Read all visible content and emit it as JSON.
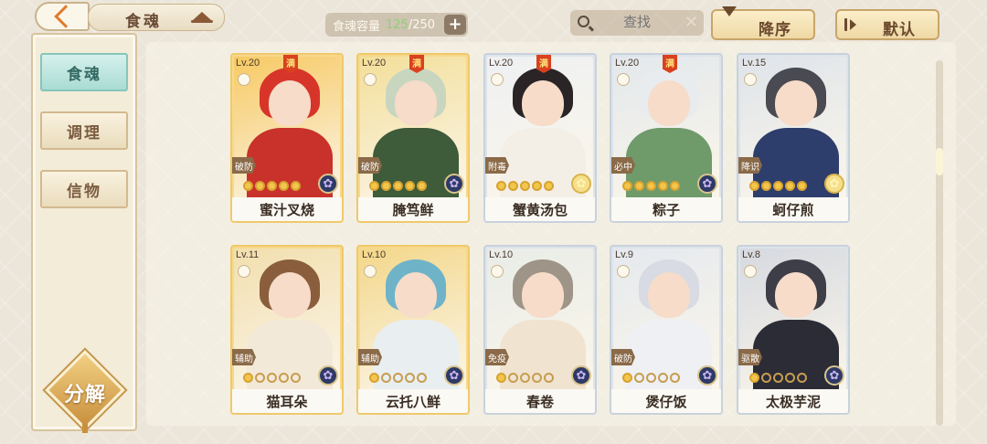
{
  "header": {
    "title": "食魂",
    "capacity_label": "食魂容量",
    "capacity_current": "125",
    "capacity_total": "/250",
    "add_label": "+",
    "search_placeholder": "查找",
    "clear_label": "✕",
    "sort_order_label": "降序",
    "sort_mode_label": "默认"
  },
  "sidebar": {
    "items": [
      {
        "label": "食魂",
        "active": true
      },
      {
        "label": "调理",
        "active": false
      },
      {
        "label": "信物",
        "active": false
      }
    ],
    "decompose_label": "分解"
  },
  "cards": [
    {
      "level": "Lv.20",
      "name": "蜜汁叉烧",
      "role": "破防",
      "full": "满",
      "stars": 5,
      "frame": "gold",
      "attr_icon": "blue-flower-icon",
      "hair": "#d8352a",
      "body": "#c9322a",
      "bg": "#f7c963"
    },
    {
      "level": "Lv.20",
      "name": "腌笃鲜",
      "role": "破防",
      "full": "满",
      "stars": 5,
      "frame": "gold",
      "attr_icon": "blue-flower-icon",
      "hair": "#c8d6c0",
      "body": "#3e5b3a",
      "bg": "#f3df9a"
    },
    {
      "level": "Lv.20",
      "name": "蟹黄汤包",
      "role": "附毒",
      "full": "满",
      "stars": 5,
      "frame": "silver",
      "attr_icon": "gold-flower-icon",
      "hair": "#2a2426",
      "body": "#f3efe6",
      "bg": "#eef0f2"
    },
    {
      "level": "Lv.20",
      "name": "粽子",
      "role": "必中",
      "full": "满",
      "stars": 5,
      "frame": "silver",
      "attr_icon": "blue-flower-icon",
      "hair": "#e9ecef",
      "body": "#6f9a6a",
      "bg": "#e3e8ec"
    },
    {
      "level": "Lv.15",
      "name": "蚵仔煎",
      "role": "降识",
      "full": "",
      "stars": 5,
      "frame": "silver",
      "attr_icon": "gold-flower-icon",
      "hair": "#4a4a52",
      "body": "#2e3e6c",
      "bg": "#dfe4ea"
    },
    {
      "level": "Lv.11",
      "name": "猫耳朵",
      "role": "辅助",
      "full": "",
      "stars": 1,
      "frame": "gold",
      "attr_icon": "blue-flower-icon",
      "hair": "#8a5e3c",
      "body": "#f3e9d8",
      "bg": "#f2dfae"
    },
    {
      "level": "Lv.10",
      "name": "云托八鲜",
      "role": "辅助",
      "full": "",
      "stars": 1,
      "frame": "gold",
      "attr_icon": "blue-flower-icon",
      "hair": "#6fb3c8",
      "body": "#e9eef0",
      "bg": "#f3d78a"
    },
    {
      "level": "Lv.10",
      "name": "春卷",
      "role": "免疫",
      "full": "",
      "stars": 1,
      "frame": "silver",
      "attr_icon": "blue-flower-icon",
      "hair": "#9e9488",
      "body": "#f0e4d0",
      "bg": "#e9ece8"
    },
    {
      "level": "Lv.9",
      "name": "煲仔饭",
      "role": "破防",
      "full": "",
      "stars": 1,
      "frame": "silver",
      "attr_icon": "blue-flower-icon",
      "hair": "#d8dbe4",
      "body": "#eef0f3",
      "bg": "#e5e9ee"
    },
    {
      "level": "Lv.8",
      "name": "太极芋泥",
      "role": "驱散",
      "full": "",
      "stars": 1,
      "frame": "silver",
      "attr_icon": "blue-flower-icon",
      "hair": "#3e3e48",
      "body": "#2c2c36",
      "bg": "#d6d9e0"
    }
  ],
  "colors": {
    "capacity_current": "#8fd07a",
    "nav_active": "#a9dcd3",
    "card_gold_frame": "#f0c96a",
    "card_silver_frame": "#c8d2dc",
    "full_badge": "#d9411f"
  }
}
